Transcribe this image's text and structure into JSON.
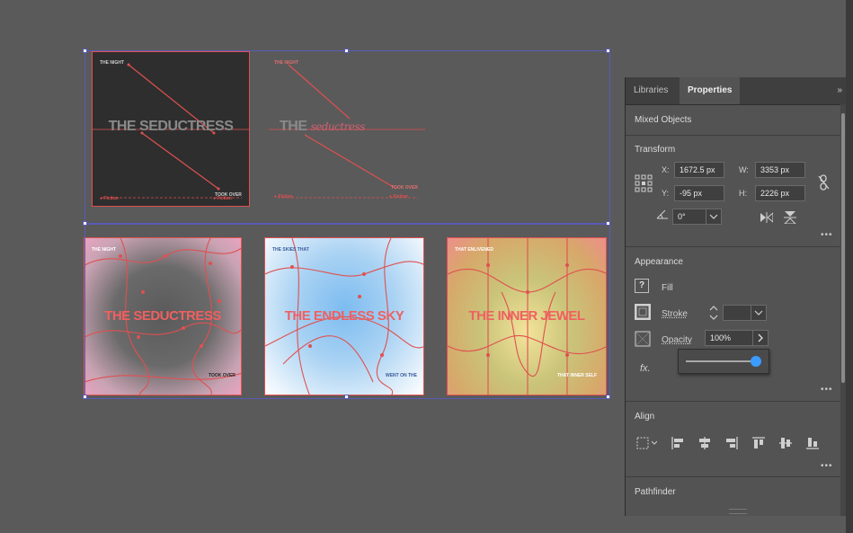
{
  "artboards": {
    "top_left": {
      "title_a": "THE SEDUCTRESS",
      "small_top": "THE NIGHT",
      "small_right": "TOOK OVER",
      "footer_left": "●  Fiction",
      "footer_right": "● Fiction"
    },
    "top_right": {
      "title_a": "THE",
      "title_b": "seductress",
      "small_top": "THE NIGHT",
      "small_right": "TOOK OVER",
      "footer_left": "●  Fiction",
      "footer_right": "● Fiction"
    },
    "bottom_1": {
      "title": "THE SEDUCTRESS",
      "small_top": "THE NIGHT",
      "small_right": "TOOK OVER"
    },
    "bottom_2": {
      "title": "THE ENDLESS SKY",
      "small_top": "THE SKIES THAT",
      "small_right": "WENT ON THE"
    },
    "bottom_3": {
      "title": "THE INNER JEWEL",
      "small_top": "THAT ENLIVENED",
      "small_right": "THAT INNER SELF"
    }
  },
  "panel": {
    "tabs": [
      "Libraries",
      "Properties"
    ],
    "active_tab": "Properties",
    "collapse_glyph": "»",
    "selection_type": "Mixed Objects",
    "transform": {
      "title": "Transform",
      "x_label": "X:",
      "x_value": "1672.5 px",
      "y_label": "Y:",
      "y_value": "-95 px",
      "w_label": "W:",
      "w_value": "3353 px",
      "h_label": "H:",
      "h_value": "2226 px",
      "angle_value": "0°"
    },
    "appearance": {
      "title": "Appearance",
      "fill_label": "Fill",
      "fill_glyph": "?",
      "stroke_label": "Stroke",
      "opacity_label": "Opacity",
      "opacity_value": "100%",
      "fx_label": "fx.",
      "opacity_slider_fraction": 1.0
    },
    "align": {
      "title": "Align"
    },
    "pathfinder": {
      "title": "Pathfinder"
    },
    "more_glyph": "•••",
    "icons": [
      "link-proportions-icon",
      "reference-point-icon",
      "flip-horizontal-icon",
      "flip-vertical-icon",
      "stroke-swatch-icon",
      "opacity-icon",
      "align-left-icon",
      "align-center-icon",
      "align-right-icon",
      "align-top-icon",
      "align-middle-icon",
      "align-bottom-icon"
    ],
    "colors": {
      "accent": "#3b9cff",
      "selection": "#5a5ab8",
      "artwork_red": "#e05050"
    }
  }
}
